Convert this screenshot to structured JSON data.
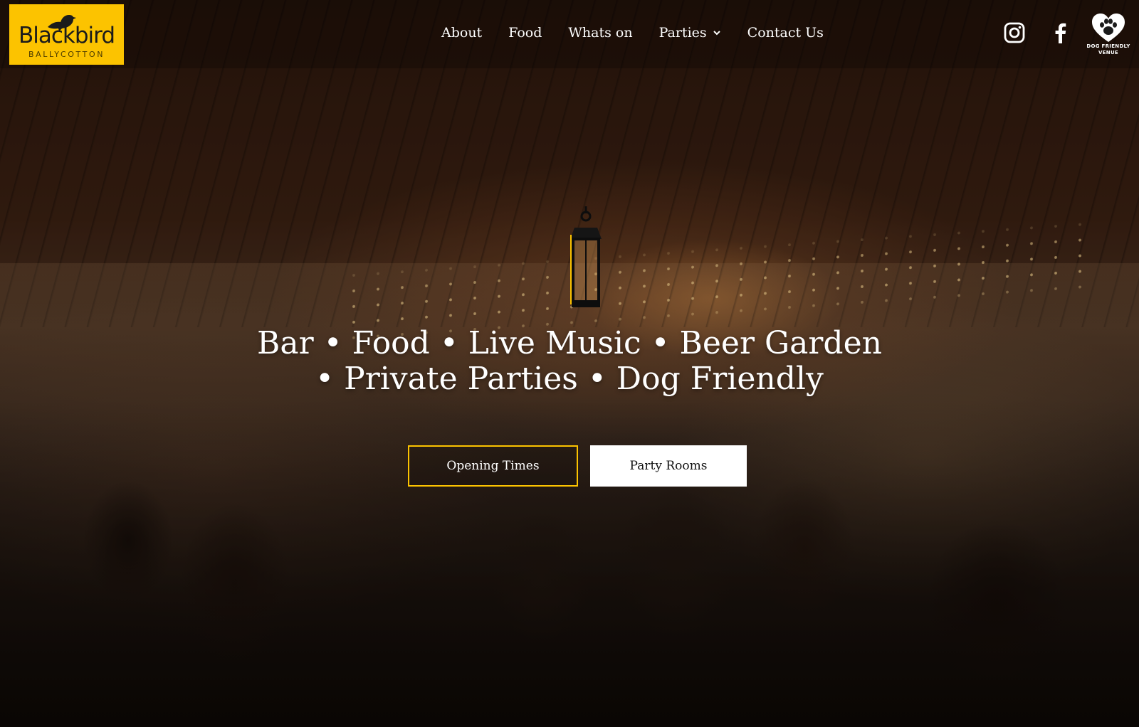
{
  "brand": {
    "name": "Blackbird",
    "subtitle": "BALLYCOTTON",
    "logo_bg": "#fcc300"
  },
  "nav": {
    "items": [
      {
        "label": "About"
      },
      {
        "label": "Food"
      },
      {
        "label": "Whats on"
      },
      {
        "label": "Parties",
        "has_dropdown": true
      },
      {
        "label": "Contact Us"
      }
    ]
  },
  "social": {
    "instagram_icon": "instagram-icon",
    "facebook_icon": "facebook-icon"
  },
  "dog_badge": {
    "line1": "DOG FRIENDLY",
    "line2": "VENUE",
    "icon": "heart-paw-icon"
  },
  "hero": {
    "tagline_line1": "Bar • Food • Live Music • Beer Garden",
    "tagline_line2": "• Private Parties • Dog Friendly",
    "accent_color": "#fcc300",
    "buttons": {
      "primary": "Opening Times",
      "secondary": "Party Rooms"
    }
  }
}
